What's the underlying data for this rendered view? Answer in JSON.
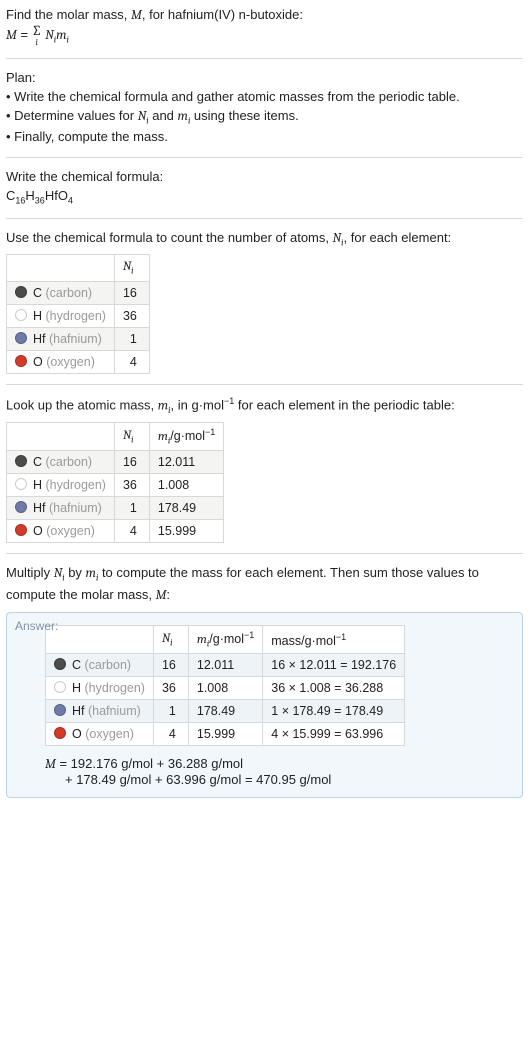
{
  "intro": {
    "line1_a": "Find the molar mass, ",
    "line1_M": "M",
    "line1_b": ", for hafnium(IV) n-butoxide:",
    "eq_M": "M",
    "eq_eq": " = ",
    "eq_sigma": "∑",
    "eq_sub": "i",
    "eq_rhs_a": "N",
    "eq_rhs_b": "m"
  },
  "plan": {
    "title": "Plan:",
    "b1": "• Write the chemical formula and gather atomic masses from the periodic table.",
    "b2_a": "• Determine values for ",
    "b2_N": "N",
    "b2_b": " and ",
    "b2_m": "m",
    "b2_c": " using these items.",
    "b3": "• Finally, compute the mass."
  },
  "formula": {
    "title": "Write the chemical formula:",
    "f_C": "C",
    "f_C_n": "16",
    "f_H": "H",
    "f_H_n": "36",
    "f_Hf": "Hf",
    "f_O": "O",
    "f_O_n": "4"
  },
  "count": {
    "title_a": "Use the chemical formula to count the number of atoms, ",
    "title_N": "N",
    "title_b": ", for each element:",
    "hdr_N": "N",
    "rows": [
      {
        "swatch": "#4c4c4c",
        "sym": "C",
        "name": "(carbon)",
        "n": "16"
      },
      {
        "swatch": "#ffffff",
        "sym": "H",
        "name": "(hydrogen)",
        "n": "36"
      },
      {
        "swatch": "#6f7aa8",
        "sym": "Hf",
        "name": "(hafnium)",
        "n": "1"
      },
      {
        "swatch": "#d23a2a",
        "sym": "O",
        "name": "(oxygen)",
        "n": "4"
      }
    ]
  },
  "atomic": {
    "title_a": "Look up the atomic mass, ",
    "title_m": "m",
    "title_b": ", in g·mol",
    "title_c": " for each element in the periodic table:",
    "hdr_N": "N",
    "hdr_m": "m",
    "hdr_unit": "/g·mol",
    "rows": [
      {
        "swatch": "#4c4c4c",
        "sym": "C",
        "name": "(carbon)",
        "n": "16",
        "m": "12.011"
      },
      {
        "swatch": "#ffffff",
        "sym": "H",
        "name": "(hydrogen)",
        "n": "36",
        "m": "1.008"
      },
      {
        "swatch": "#6f7aa8",
        "sym": "Hf",
        "name": "(hafnium)",
        "n": "1",
        "m": "178.49"
      },
      {
        "swatch": "#d23a2a",
        "sym": "O",
        "name": "(oxygen)",
        "n": "4",
        "m": "15.999"
      }
    ]
  },
  "multiply": {
    "title_a": "Multiply ",
    "title_N": "N",
    "title_b": " by ",
    "title_m": "m",
    "title_c": " to compute the mass for each element. Then sum those values to compute the molar mass, ",
    "title_M": "M",
    "title_d": ":"
  },
  "answer": {
    "label": "Answer:",
    "hdr_N": "N",
    "hdr_m": "m",
    "hdr_unit": "/g·mol",
    "hdr_mass": "mass/g·mol",
    "rows": [
      {
        "swatch": "#4c4c4c",
        "sym": "C",
        "name": "(carbon)",
        "n": "16",
        "m": "12.011",
        "calc": "16 × 12.011 = 192.176"
      },
      {
        "swatch": "#ffffff",
        "sym": "H",
        "name": "(hydrogen)",
        "n": "36",
        "m": "1.008",
        "calc": "36 × 1.008 = 36.288"
      },
      {
        "swatch": "#6f7aa8",
        "sym": "Hf",
        "name": "(hafnium)",
        "n": "1",
        "m": "178.49",
        "calc": "1 × 178.49 = 178.49"
      },
      {
        "swatch": "#d23a2a",
        "sym": "O",
        "name": "(oxygen)",
        "n": "4",
        "m": "15.999",
        "calc": "4 × 15.999 = 63.996"
      }
    ],
    "result_M": "M",
    "result_l1": " = 192.176 g/mol + 36.288 g/mol",
    "result_l2": "+ 178.49 g/mol + 63.996 g/mol = 470.95 g/mol"
  },
  "sub_i": "i",
  "neg1": "−1"
}
